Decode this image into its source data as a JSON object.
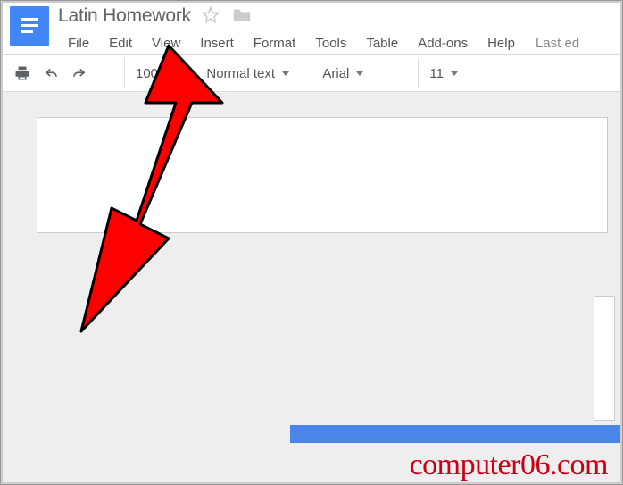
{
  "doc": {
    "title": "Latin Homework"
  },
  "menus": {
    "file": "File",
    "edit": "Edit",
    "view": "View",
    "insert": "Insert",
    "format": "Format",
    "tools": "Tools",
    "table": "Table",
    "addons": "Add-ons",
    "help": "Help",
    "last_edit": "Last ed"
  },
  "toolbar": {
    "zoom": "100%",
    "style": "Normal text",
    "font": "Arial",
    "font_size": "11"
  },
  "watermark": {
    "text": "computer06.com"
  }
}
